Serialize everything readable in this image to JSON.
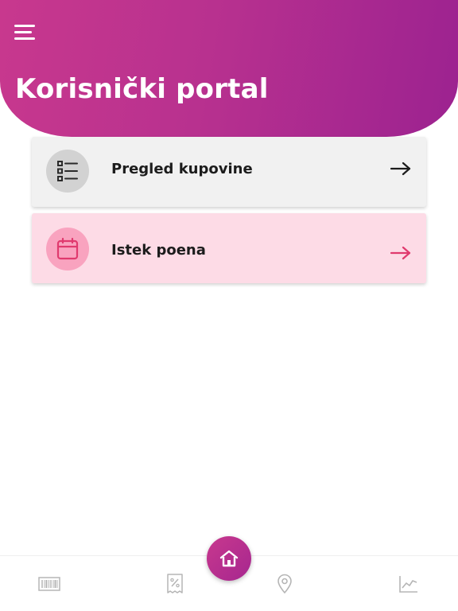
{
  "header": {
    "title": "Korisnički portal",
    "menu_icon": "hamburger-menu-icon",
    "gradient_start": "#c8388e",
    "gradient_end": "#9c2290"
  },
  "cards": [
    {
      "label": "Pregled kupovine",
      "icon": "list-icon",
      "background": "#f1f1f1",
      "arrow_color": "#1c1c1c"
    },
    {
      "label": "Istek poena",
      "icon": "calendar-icon",
      "background": "#fddbe6",
      "arrow_color": "#e03a6e"
    }
  ],
  "bottom_nav": {
    "items": [
      {
        "icon": "barcode-icon"
      },
      {
        "icon": "receipt-percent-icon"
      },
      {
        "icon": "home-icon",
        "active": true
      },
      {
        "icon": "location-pin-icon"
      },
      {
        "icon": "chart-icon"
      }
    ],
    "accent": "#b8318f"
  }
}
